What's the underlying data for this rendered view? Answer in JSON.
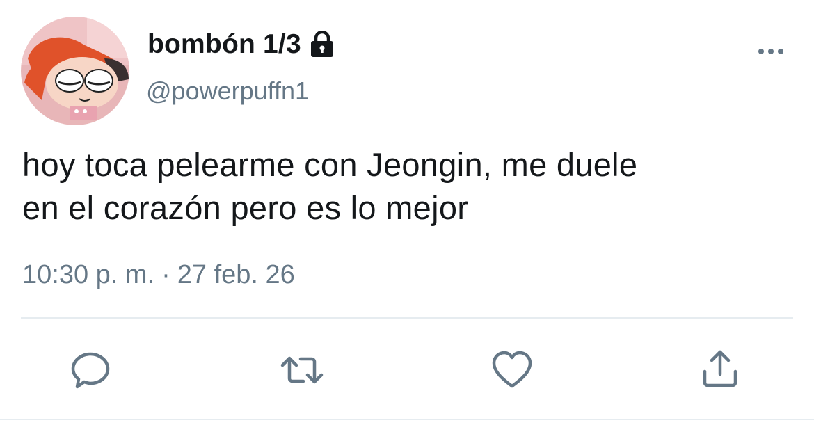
{
  "tweet": {
    "display_name": "bombón 1/3",
    "handle": "@powerpuffn1",
    "protected": true,
    "text_lines": [
      "hoy toca pelearme con Jeongin, me duele",
      "en el corazón pero es lo mejor"
    ],
    "time": "10:30 p. m.",
    "separator": "·",
    "date": "27 feb. 26"
  },
  "icons": {
    "lock": "lock-icon",
    "more": "more-horizontal-icon",
    "reply": "reply-bubble-icon",
    "retweet": "retweet-icon",
    "like": "heart-icon",
    "share": "share-upload-icon"
  },
  "colors": {
    "text": "#14171a",
    "secondary": "#657786",
    "icon": "#657786",
    "divider": "#e6ecf0",
    "background": "#ffffff"
  }
}
